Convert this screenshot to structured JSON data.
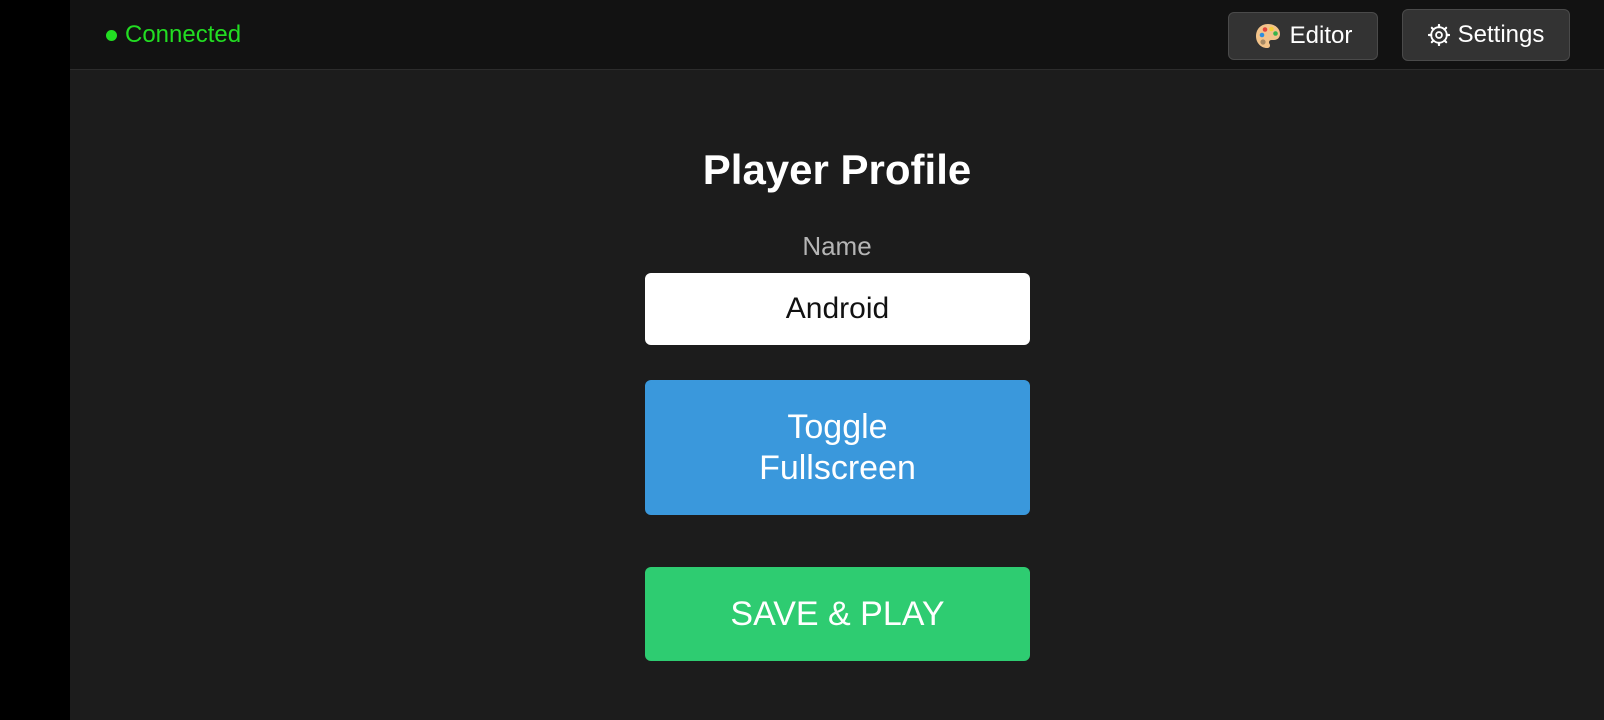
{
  "status": {
    "text": "Connected",
    "color": "#22dd22"
  },
  "toolbar": {
    "editor_label": "Editor",
    "editor_icon": "palette-icon",
    "settings_label": "Settings",
    "settings_icon": "gear-icon"
  },
  "profile": {
    "title": "Player Profile",
    "name_label": "Name",
    "name_value": "Android"
  },
  "actions": {
    "fullscreen_label": "Toggle Fullscreen",
    "fullscreen_color": "#3a98dc",
    "save_label": "SAVE & PLAY",
    "save_color": "#2ecc71"
  }
}
